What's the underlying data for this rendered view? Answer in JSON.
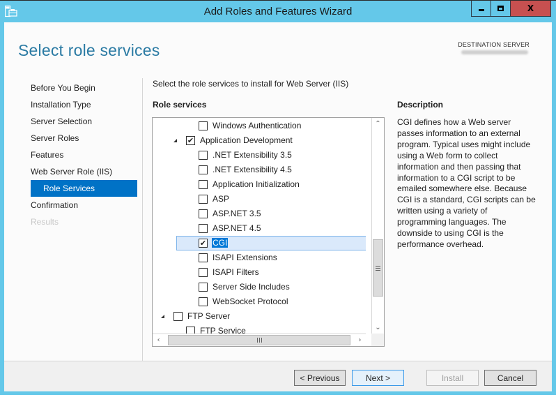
{
  "window": {
    "title": "Add Roles and Features Wizard",
    "controls": {
      "minimize": "minimize",
      "maximize": "maximize",
      "close": "X"
    }
  },
  "page": {
    "title": "Select role services",
    "destination_label": "DESTINATION SERVER",
    "destination_value_blurred": true
  },
  "nav": {
    "items": [
      {
        "label": "Before You Begin",
        "state": "normal"
      },
      {
        "label": "Installation Type",
        "state": "normal"
      },
      {
        "label": "Server Selection",
        "state": "normal"
      },
      {
        "label": "Server Roles",
        "state": "normal"
      },
      {
        "label": "Features",
        "state": "normal"
      },
      {
        "label": "Web Server Role (IIS)",
        "state": "normal"
      },
      {
        "label": "Role Services",
        "state": "active"
      },
      {
        "label": "Confirmation",
        "state": "normal"
      },
      {
        "label": "Results",
        "state": "disabled"
      }
    ]
  },
  "main": {
    "instructions": "Select the role services to install for Web Server (IIS)",
    "role_services_header": "Role services",
    "tree": [
      {
        "label": "Windows Authentication",
        "level": 2,
        "checked": false,
        "expandable": false
      },
      {
        "label": "Application Development",
        "level": 1,
        "checked": true,
        "expandable": true,
        "expanded": true
      },
      {
        "label": ".NET Extensibility 3.5",
        "level": 2,
        "checked": false,
        "expandable": false
      },
      {
        "label": ".NET Extensibility 4.5",
        "level": 2,
        "checked": false,
        "expandable": false
      },
      {
        "label": "Application Initialization",
        "level": 2,
        "checked": false,
        "expandable": false
      },
      {
        "label": "ASP",
        "level": 2,
        "checked": false,
        "expandable": false
      },
      {
        "label": "ASP.NET 3.5",
        "level": 2,
        "checked": false,
        "expandable": false
      },
      {
        "label": "ASP.NET 4.5",
        "level": 2,
        "checked": false,
        "expandable": false
      },
      {
        "label": "CGI",
        "level": 2,
        "checked": true,
        "expandable": false,
        "selected": true
      },
      {
        "label": "ISAPI Extensions",
        "level": 2,
        "checked": false,
        "expandable": false
      },
      {
        "label": "ISAPI Filters",
        "level": 2,
        "checked": false,
        "expandable": false
      },
      {
        "label": "Server Side Includes",
        "level": 2,
        "checked": false,
        "expandable": false
      },
      {
        "label": "WebSocket Protocol",
        "level": 2,
        "checked": false,
        "expandable": false
      },
      {
        "label": "FTP Server",
        "level": 0,
        "checked": false,
        "expandable": true,
        "expanded": true
      },
      {
        "label": "FTP Service",
        "level": 1,
        "checked": false,
        "expandable": false
      }
    ],
    "scroll": {
      "up": "^",
      "down": "v",
      "left": "<",
      "right": ">",
      "vertical_position_fraction": 0.62
    }
  },
  "description": {
    "header": "Description",
    "text": "CGI defines how a Web server passes information to an external program. Typical uses might include using a Web form to collect information and then passing that information to a CGI script to be emailed somewhere else. Because CGI is a standard, CGI scripts can be written using a variety of programming languages. The downside to using CGI is the performance overhead."
  },
  "footer": {
    "previous": "< Previous",
    "next": "Next >",
    "install": "Install",
    "cancel": "Cancel"
  }
}
